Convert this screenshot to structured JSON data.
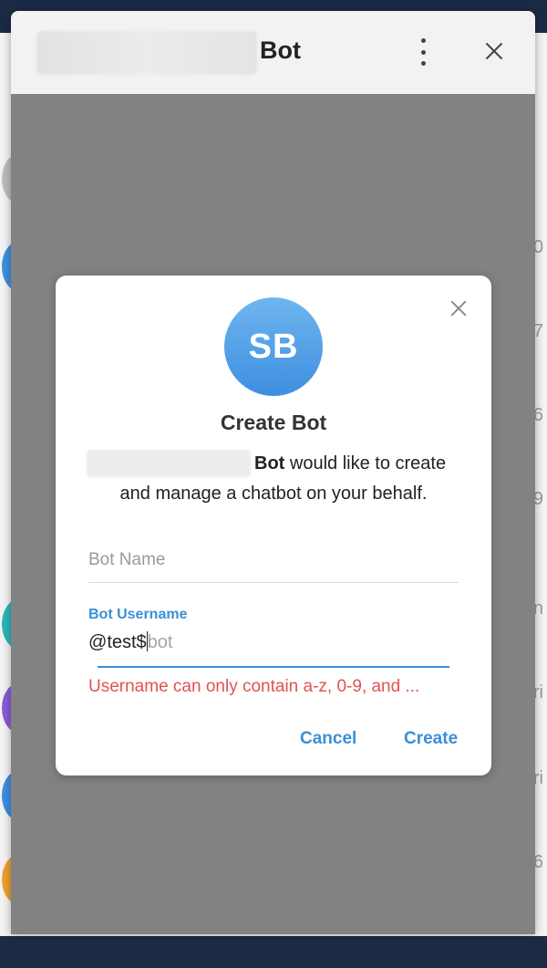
{
  "header": {
    "title": "Bot",
    "menu_icon": "kebab-menu-icon",
    "close_icon": "close-icon"
  },
  "background_list": {
    "numbers": [
      "0",
      "7",
      "6",
      "9",
      "n",
      "ri",
      "ri",
      "6"
    ]
  },
  "dialog": {
    "avatar_initials": "SB",
    "title": "Create Bot",
    "description_bold": "Bot",
    "description_line1_rest": " would like to create",
    "description_line2": "and manage a chatbot on your behalf.",
    "bot_name_placeholder": "Bot Name",
    "bot_name_value": "",
    "username_label": "Bot Username",
    "username_prefix": "@",
    "username_value": "test$",
    "username_suffix": "bot",
    "error": "Username can only contain a-z, 0-9, and ...",
    "cancel_label": "Cancel",
    "create_label": "Create"
  },
  "colors": {
    "accent": "#3a8fd6",
    "error": "#e05350",
    "overlay": "#828282"
  }
}
